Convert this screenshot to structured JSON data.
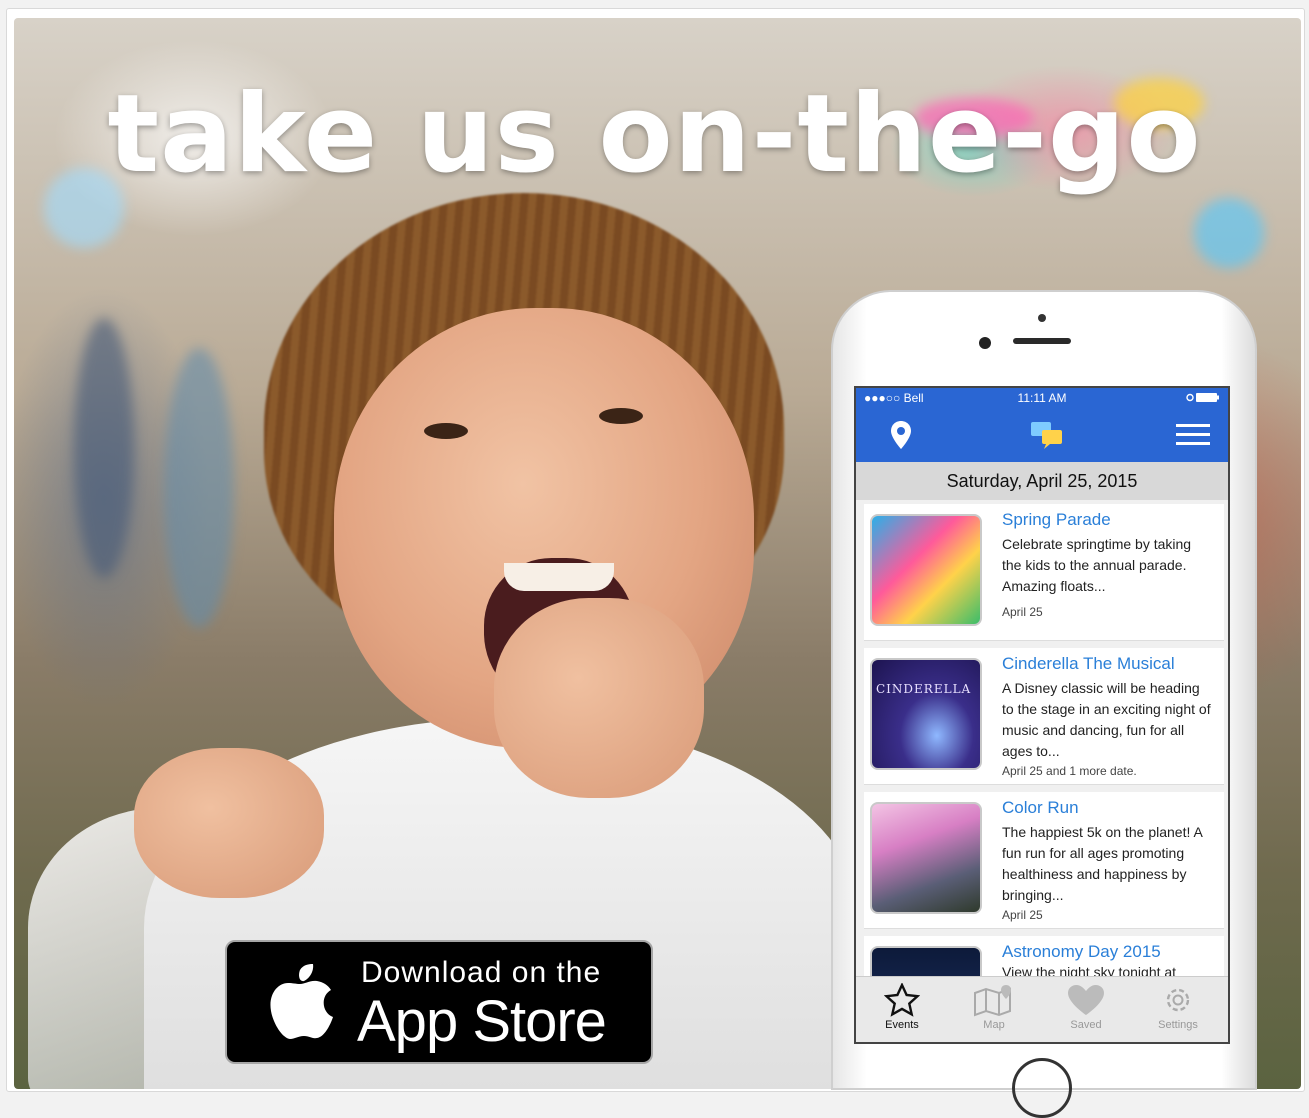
{
  "headline": "take us on-the-go",
  "app_store_badge": {
    "line1": "Download on the",
    "line2": "App Store",
    "icon": "apple-logo-icon"
  },
  "phone": {
    "status_bar": {
      "carrier": "●●●○○ Bell",
      "time": "11:11 AM"
    },
    "nav_icons": [
      "location-pin-icon",
      "chat-bubbles-icon",
      "hamburger-menu-icon"
    ],
    "date_header": "Saturday, April 25, 2015",
    "events": [
      {
        "title": "Spring Parade",
        "description": "Celebrate springtime by taking the kids to the annual parade. Amazing floats...",
        "date": "April 25"
      },
      {
        "title": "Cinderella The Musical",
        "description": "A Disney classic will be heading to the stage in an exciting night of music and dancing, fun for all ages to...",
        "date": "April 25 and 1 more date.",
        "thumb_text": "CINDERELLA"
      },
      {
        "title": "Color Run",
        "description": "The happiest 5k on the planet! A fun run for all ages promoting healthiness and happiness by bringing...",
        "date": "April 25"
      },
      {
        "title": "Astronomy Day 2015",
        "description": "View the night sky tonight at",
        "date": ""
      }
    ],
    "tabs": [
      {
        "label": "Events",
        "icon": "star-icon",
        "active": true
      },
      {
        "label": "Map",
        "icon": "map-icon",
        "active": false
      },
      {
        "label": "Saved",
        "icon": "heart-icon",
        "active": false
      },
      {
        "label": "Settings",
        "icon": "gear-icon",
        "active": false
      }
    ]
  },
  "colors": {
    "app_blue": "#2a66d3",
    "link_blue": "#2a7fd8",
    "badge_black": "#000000"
  }
}
